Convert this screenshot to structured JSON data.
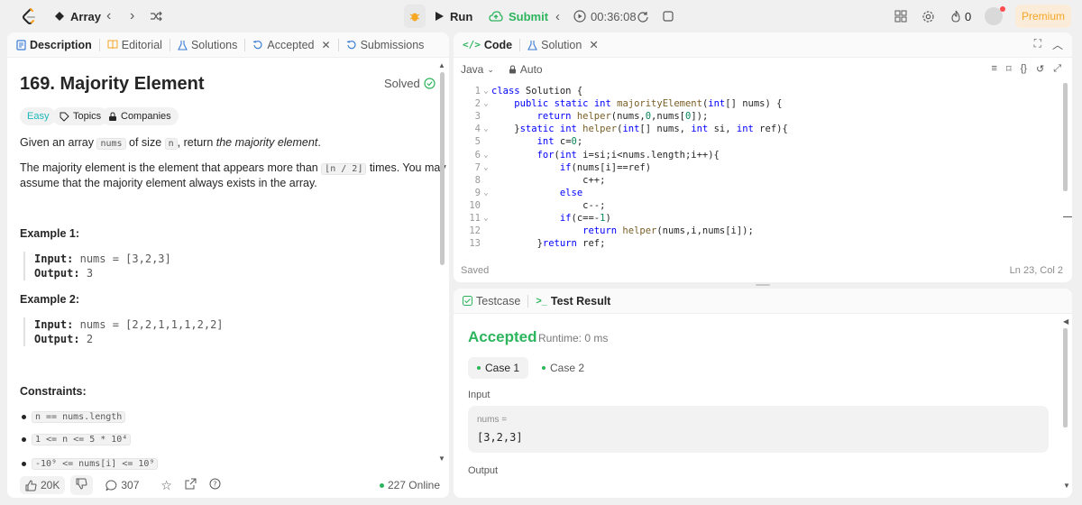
{
  "topbar": {
    "problem_list_label": "Array",
    "run_label": "Run",
    "submit_label": "Submit",
    "timer": "00:36:08",
    "streak_count": "0",
    "premium_label": "Premium"
  },
  "left_tabs": [
    {
      "label": "Description"
    },
    {
      "label": "Editorial"
    },
    {
      "label": "Solutions"
    },
    {
      "label": "Accepted"
    },
    {
      "label": "Submissions"
    }
  ],
  "problem": {
    "title": "169. Majority Element",
    "status": "Solved",
    "difficulty": "Easy",
    "topics_label": "Topics",
    "companies_label": "Companies",
    "desc1_pre": "Given an array ",
    "desc1_code1": "nums",
    "desc1_mid": " of size ",
    "desc1_code2": "n",
    "desc1_post": ", return ",
    "desc1_em": "the majority element",
    "desc1_end": ".",
    "desc2_pre": "The majority element is the element that appears more than ",
    "desc2_code": "⌊n / 2⌋",
    "desc2_post": " times. You may",
    "desc2_line2": "assume that the majority element always exists in the array.",
    "examples": [
      {
        "label": "Example 1:",
        "input_key": "Input:",
        "input": "nums = [3,2,3]",
        "output_key": "Output:",
        "output": "3"
      },
      {
        "label": "Example 2:",
        "input_key": "Input:",
        "input": "nums = [2,2,1,1,1,2,2]",
        "output_key": "Output:",
        "output": "2"
      }
    ],
    "constraints_label": "Constraints:",
    "constraints": [
      "n == nums.length",
      "1 <= n <= 5 * 10⁴",
      "-10⁹ <= nums[i] <= 10⁹"
    ]
  },
  "left_footer": {
    "likes": "20K",
    "comments": "307",
    "online": "227 Online"
  },
  "code_panel": {
    "tab_code": "Code",
    "tab_solution": "Solution",
    "language": "Java",
    "mode": "Auto",
    "saved": "Saved",
    "cursor": "Ln 23, Col 2",
    "lines": [
      {
        "n": "1",
        "fold": true,
        "text": "class Solution {"
      },
      {
        "n": "2",
        "fold": true,
        "text": "    public static int majorityElement(int[] nums) {"
      },
      {
        "n": "3",
        "fold": false,
        "text": "        return helper(nums,0,nums[0]);"
      },
      {
        "n": "4",
        "fold": true,
        "text": "    }static int helper(int[] nums, int si, int ref){"
      },
      {
        "n": "5",
        "fold": false,
        "text": "        int c=0;"
      },
      {
        "n": "6",
        "fold": true,
        "text": "        for(int i=si;i<nums.length;i++){"
      },
      {
        "n": "7",
        "fold": true,
        "text": "            if(nums[i]==ref)"
      },
      {
        "n": "8",
        "fold": false,
        "text": "                c++;"
      },
      {
        "n": "9",
        "fold": true,
        "text": "            else"
      },
      {
        "n": "10",
        "fold": false,
        "text": "                c--;"
      },
      {
        "n": "11",
        "fold": true,
        "text": "            if(c==-1)"
      },
      {
        "n": "12",
        "fold": false,
        "text": "                return helper(nums,i,nums[i]);"
      },
      {
        "n": "13",
        "fold": false,
        "text": "        }return ref;"
      }
    ]
  },
  "test_panel": {
    "tab_testcase": "Testcase",
    "tab_result": "Test Result",
    "verdict": "Accepted",
    "runtime": "Runtime: 0 ms",
    "case1": "Case 1",
    "case2": "Case 2",
    "input_label": "Input",
    "input_var": "nums =",
    "input_value": "[3,2,3]",
    "output_label": "Output"
  },
  "colors": {
    "accent_green": "#2db55d",
    "premium_orange": "#f5a623",
    "submit_green": "#2db55d"
  }
}
